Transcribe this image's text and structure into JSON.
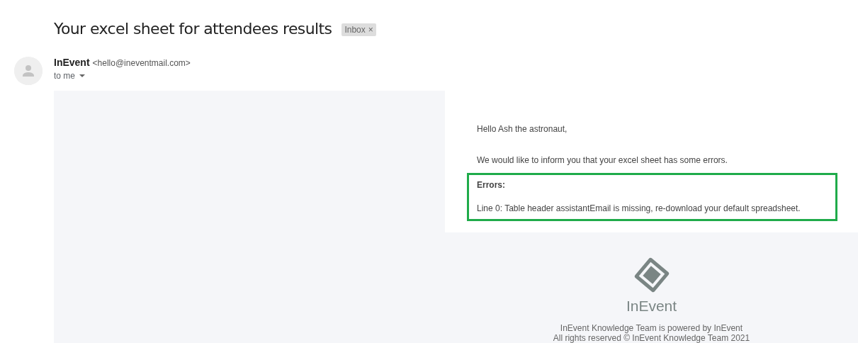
{
  "subject": {
    "title": "Your excel sheet for attendees results",
    "label": "Inbox",
    "label_close": "×"
  },
  "sender": {
    "name": "InEvent",
    "address": "<hello@ineventmail.com>",
    "recipient": "to me"
  },
  "message": {
    "greeting": "Hello Ash the astronaut,",
    "intro": "We would like to inform you that your excel sheet has some errors.",
    "errors_title": "Errors:",
    "errors": [
      "Line 0: Table header assistantEmail is missing, re-download your default spreadsheet."
    ]
  },
  "footer": {
    "brand": "InEvent",
    "lines": [
      "InEvent Knowledge Team is powered by InEvent",
      "All rights reserved © InEvent Knowledge Team 2021"
    ]
  }
}
